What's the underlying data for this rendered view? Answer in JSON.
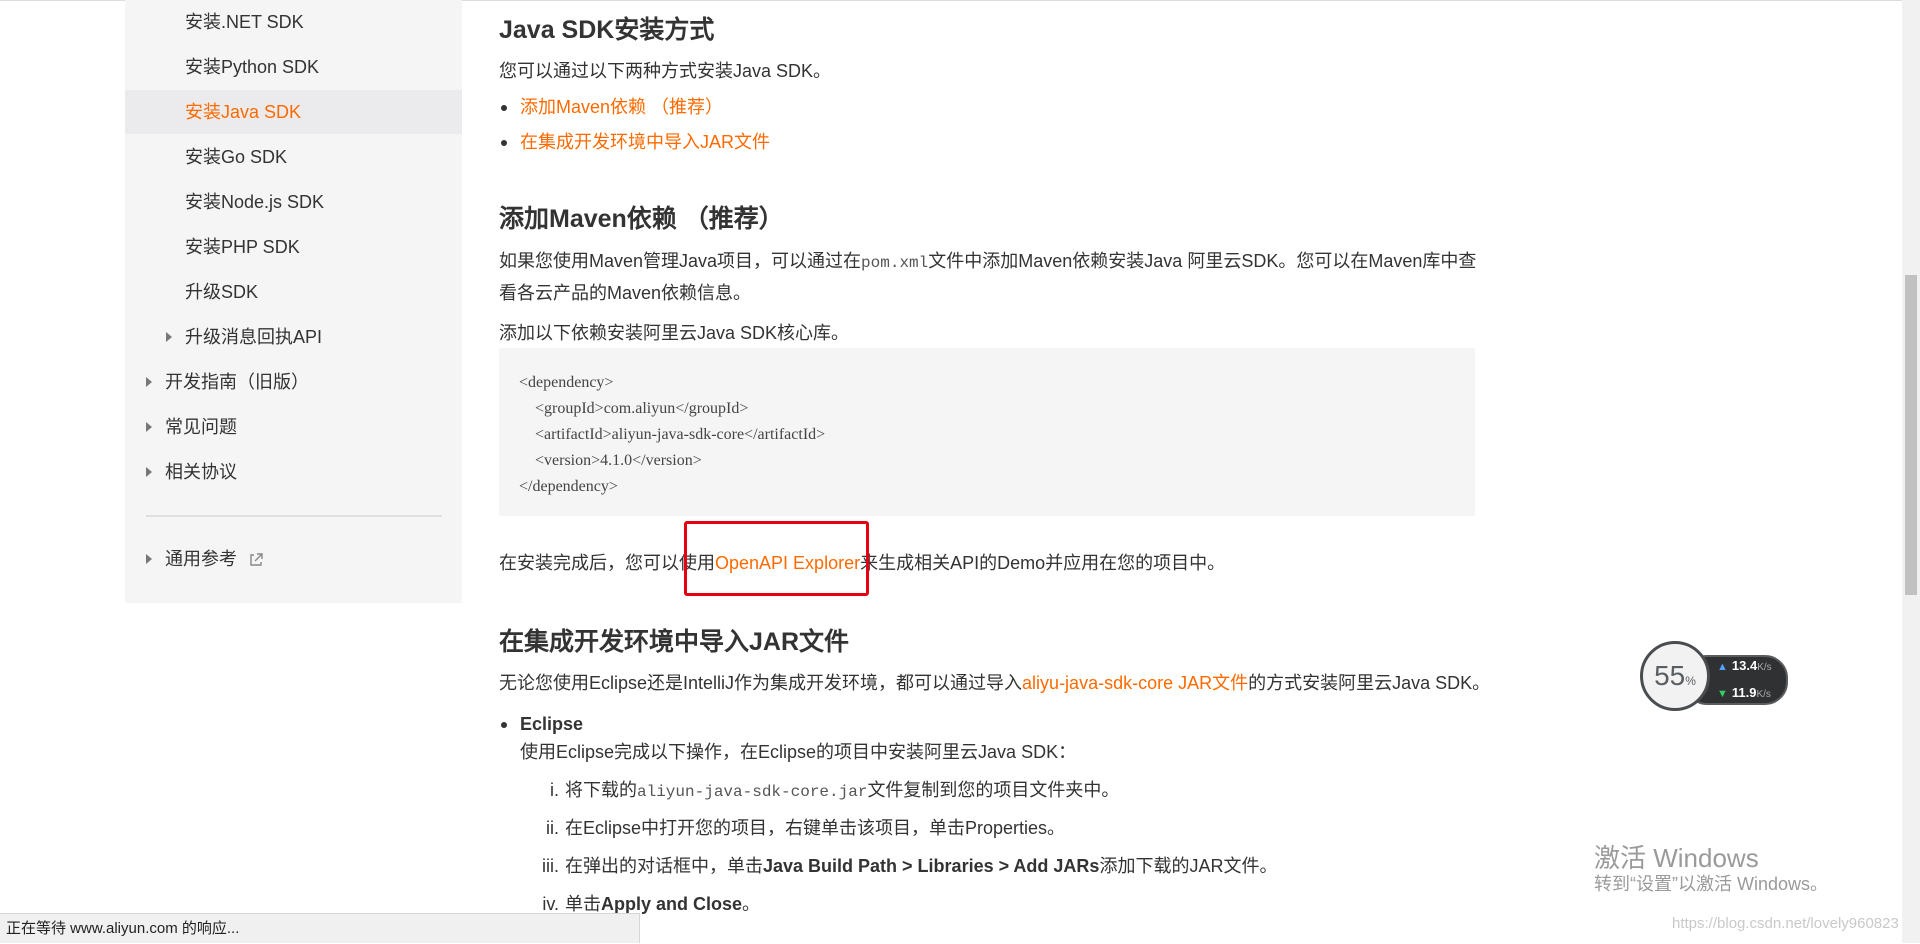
{
  "sidebar": {
    "items": [
      {
        "label": "安装.NET SDK"
      },
      {
        "label": "安装Python SDK"
      },
      {
        "label": "安装Java SDK"
      },
      {
        "label": "安装Go SDK"
      },
      {
        "label": "安装Node.js SDK"
      },
      {
        "label": "安装PHP SDK"
      },
      {
        "label": "升级SDK"
      },
      {
        "label": "升级消息回执API"
      },
      {
        "label": "开发指南（旧版）"
      },
      {
        "label": "常见问题"
      },
      {
        "label": "相关协议"
      },
      {
        "label": "通用参考"
      }
    ],
    "active_color": "#ff6a00"
  },
  "content": {
    "h1": "Java SDK安装方式",
    "intro": "您可以通过以下两种方式安装Java SDK。",
    "toc": [
      "添加Maven依赖 （推荐）",
      "在集成开发环境中导入JAR文件"
    ],
    "maven": {
      "title": "添加Maven依赖 （推荐）",
      "p1_a": "如果您使用Maven管理Java项目，可以通过在",
      "p1_code": "pom.xml",
      "p1_b": "文件中添加Maven依赖安装Java 阿里云SDK。您可以在Maven库中查看各云产品的Maven依赖信息。",
      "p2": "添加以下依赖安装阿里云Java SDK核心库。",
      "code": [
        "<dependency>",
        "    <groupId>com.aliyun</groupId>",
        "    <artifactId>aliyun-java-sdk-core</artifactId>",
        "    <version>4.1.0</version>",
        "</dependency>"
      ],
      "after_a": "在安装完成后，您可以使用",
      "after_link": "OpenAPI Explorer",
      "after_b": "来生成相关API的Demo并应用在您的项目中。"
    },
    "jar": {
      "title": "在集成开发环境中导入JAR文件",
      "p1_a": "无论您使用Eclipse还是IntelliJ作为集成开发环境，都可以通过导入",
      "p1_link": "aliyu-java-sdk-core JAR文件",
      "p1_b": "的方式安装阿里云Java SDK。",
      "eclipse_title": "Eclipse",
      "eclipse_desc": "使用Eclipse完成以下操作，在Eclipse的项目中安装阿里云Java SDK：",
      "steps": [
        {
          "num": "i.",
          "a": "将下载的",
          "code": "aliyun-java-sdk-core.jar",
          "b": "文件复制到您的项目文件夹中。"
        },
        {
          "num": "ii.",
          "a": "在Eclipse中打开您的项目，右键单击该项目，单击Properties。"
        },
        {
          "num": "iii.",
          "a": "在弹出的对话框中，单击",
          "bold": "Java Build Path > Libraries > Add JARs",
          "b": "添加下载的JAR文件。"
        },
        {
          "num": "iv.",
          "a": "单击",
          "bold": "Apply and Close",
          "b": "。"
        }
      ]
    }
  },
  "statusbar": {
    "text": "正在等待 www.aliyun.com 的响应..."
  },
  "speed_widget": {
    "percent": "55",
    "percent_unit": "%",
    "up": "13.4",
    "down": "11.9",
    "unit": "K/s"
  },
  "watermark": {
    "title": "激活 Windows",
    "subtitle": "转到“设置”以激活 Windows。",
    "csdn": "https://blog.csdn.net/lovely960823"
  }
}
